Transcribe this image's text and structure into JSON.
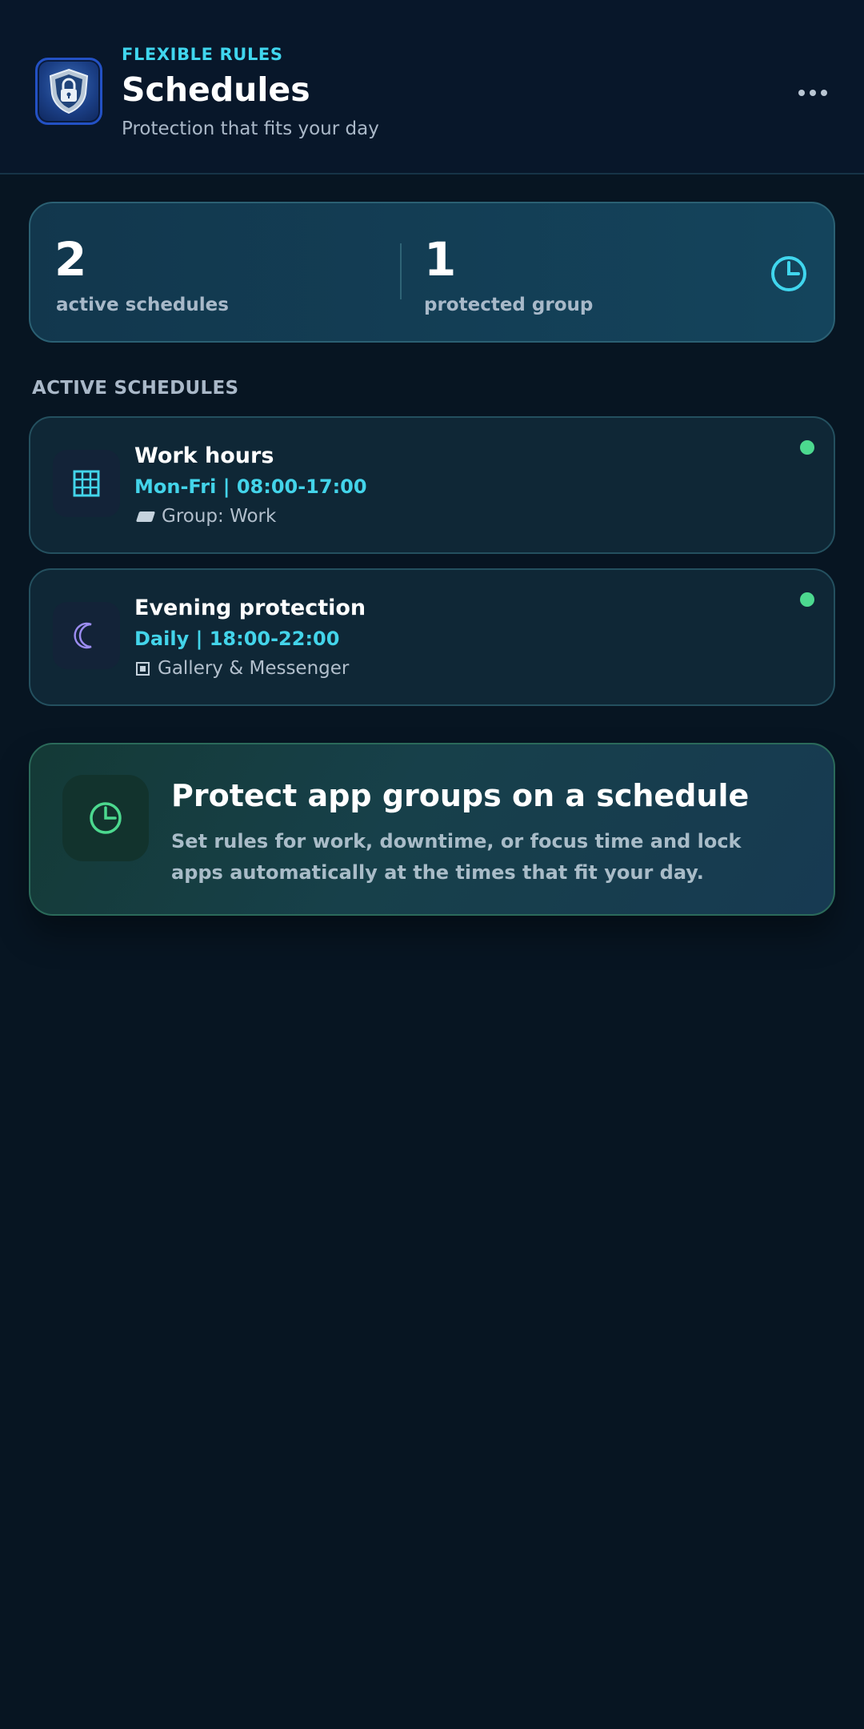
{
  "header": {
    "eyebrow": "FLEXIBLE RULES",
    "title": "Schedules",
    "subtitle": "Protection that fits your day",
    "logo_icon": "shield-lock-icon",
    "more_icon": "more-horizontal-icon"
  },
  "stats": {
    "active_count": "2",
    "active_label": "active schedules",
    "protected_count": "1",
    "protected_label": "protected group",
    "icon": "clock-icon"
  },
  "section": {
    "heading": "ACTIVE SCHEDULES"
  },
  "schedules": [
    {
      "title": "Work hours",
      "time": "Mon-Fri | 08:00-17:00",
      "target": "Group: Work",
      "icon": "calendar-grid-icon",
      "target_icon": "folder-icon",
      "active": true
    },
    {
      "title": "Evening protection",
      "time": "Daily | 18:00-22:00",
      "target": "Gallery & Messenger",
      "icon": "moon-icon",
      "target_icon": "app-icon",
      "active": true
    }
  ],
  "promo": {
    "title": "Protect app groups on a schedule",
    "body": "Set rules for work, downtime, or focus time and lock apps automatically at the times that fit your day.",
    "icon": "clock-icon"
  },
  "colors": {
    "background": "#071522",
    "accent_cyan": "#40d6ee",
    "active_green": "#4cd98f",
    "moon_purple": "#9b8cf0"
  }
}
